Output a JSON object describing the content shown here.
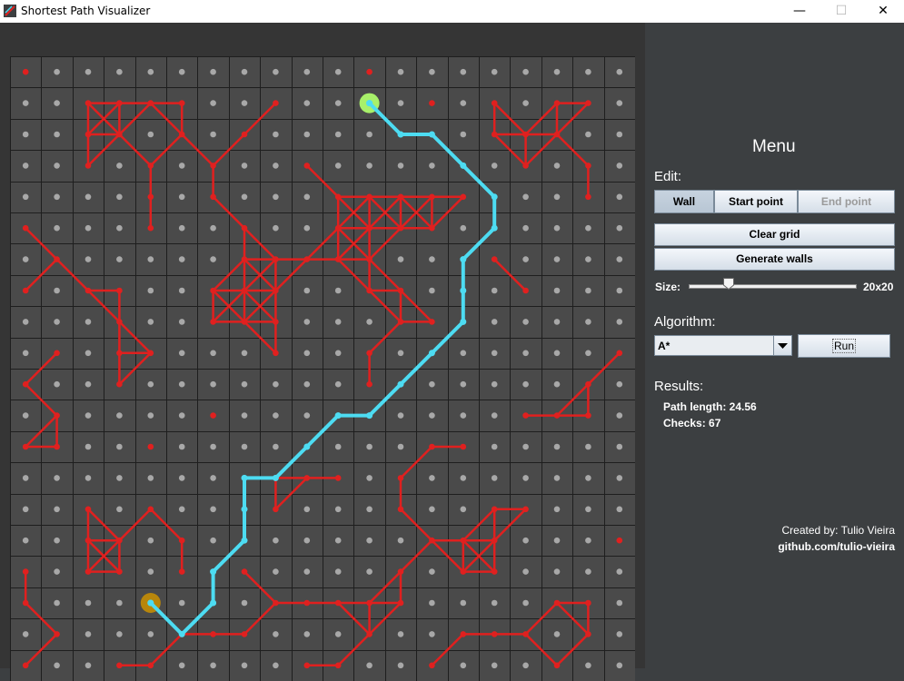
{
  "window": {
    "title": "Shortest Path Visualizer",
    "minimize": "—",
    "maximize": "☐",
    "close": "✕"
  },
  "menu": {
    "heading": "Menu",
    "edit_label": "Edit:",
    "edit_buttons": [
      "Wall",
      "Start point",
      "End point"
    ],
    "clear_label": "Clear grid",
    "generate_label": "Generate walls",
    "size_label": "Size:",
    "size_value": "20x20",
    "size_slider_fraction": 0.25,
    "algorithm_label": "Algorithm:",
    "algorithm_value": "A*",
    "run_label": "Run",
    "results_label": "Results:",
    "path_length": "Path length: 24.56",
    "checks": "Checks: 67",
    "credit": "Created by: Tulio Vieira",
    "github": "github.com/tulio-vieira"
  },
  "grid": {
    "rows": 20,
    "cols": 20,
    "start": [
      1,
      11
    ],
    "end": [
      17,
      4
    ],
    "walls": [
      "0,0",
      "0,11",
      "1,2",
      "1,3",
      "1,4",
      "1,5",
      "1,8",
      "1,13",
      "1,15",
      "1,17",
      "1,18",
      "2,2",
      "2,3",
      "2,5",
      "2,7",
      "2,15",
      "2,16",
      "2,17",
      "3,2",
      "3,4",
      "3,6",
      "3,9",
      "3,16",
      "3,18",
      "4,4",
      "4,6",
      "4,10",
      "4,11",
      "4,12",
      "4,13",
      "4,14",
      "4,18",
      "5,0",
      "5,4",
      "5,7",
      "5,10",
      "5,11",
      "5,12",
      "5,13",
      "6,1",
      "6,7",
      "6,8",
      "6,9",
      "6,10",
      "6,11",
      "6,15",
      "7,0",
      "7,2",
      "7,3",
      "7,6",
      "7,7",
      "7,8",
      "7,11",
      "7,12",
      "7,16",
      "8,3",
      "8,6",
      "8,7",
      "8,8",
      "8,12",
      "8,13",
      "9,1",
      "9,3",
      "9,4",
      "9,8",
      "9,11",
      "9,19",
      "10,0",
      "10,3",
      "10,11",
      "10,18",
      "11,1",
      "11,6",
      "11,16",
      "11,17",
      "11,18",
      "12,0",
      "12,1",
      "12,4",
      "12,13",
      "12,14",
      "13,8",
      "13,9",
      "13,10",
      "13,12",
      "14,2",
      "14,4",
      "14,8",
      "14,12",
      "14,15",
      "14,16",
      "15,2",
      "15,3",
      "15,5",
      "15,13",
      "15,14",
      "15,15",
      "15,19",
      "16,0",
      "16,2",
      "16,3",
      "16,5",
      "16,7",
      "16,12",
      "16,14",
      "16,15",
      "17,0",
      "17,8",
      "17,9",
      "17,10",
      "17,11",
      "17,12",
      "17,17",
      "17,18",
      "18,1",
      "18,5",
      "18,6",
      "18,7",
      "18,11",
      "18,14",
      "18,15",
      "18,16",
      "18,18",
      "19,0",
      "19,3",
      "19,4",
      "19,9",
      "19,10",
      "19,13",
      "19,17"
    ]
  },
  "path": [
    [
      1,
      11
    ],
    [
      2,
      12
    ],
    [
      2,
      13
    ],
    [
      3,
      14
    ],
    [
      4,
      15
    ],
    [
      5,
      15
    ],
    [
      6,
      14
    ],
    [
      7,
      14
    ],
    [
      8,
      14
    ],
    [
      9,
      13
    ],
    [
      10,
      12
    ],
    [
      11,
      11
    ],
    [
      11,
      10
    ],
    [
      12,
      9
    ],
    [
      13,
      8
    ],
    [
      13,
      7
    ],
    [
      14,
      7
    ],
    [
      15,
      7
    ],
    [
      16,
      6
    ],
    [
      17,
      6
    ],
    [
      18,
      5
    ],
    [
      17,
      4
    ]
  ],
  "colors": {
    "wall": "#e0201f",
    "path": "#4ddcf2",
    "start": "#a8f06a",
    "end": "#b8860b",
    "cell": "#4a4a4a",
    "gridline": "#1e1e1e",
    "dot": "#a8a8a8"
  }
}
